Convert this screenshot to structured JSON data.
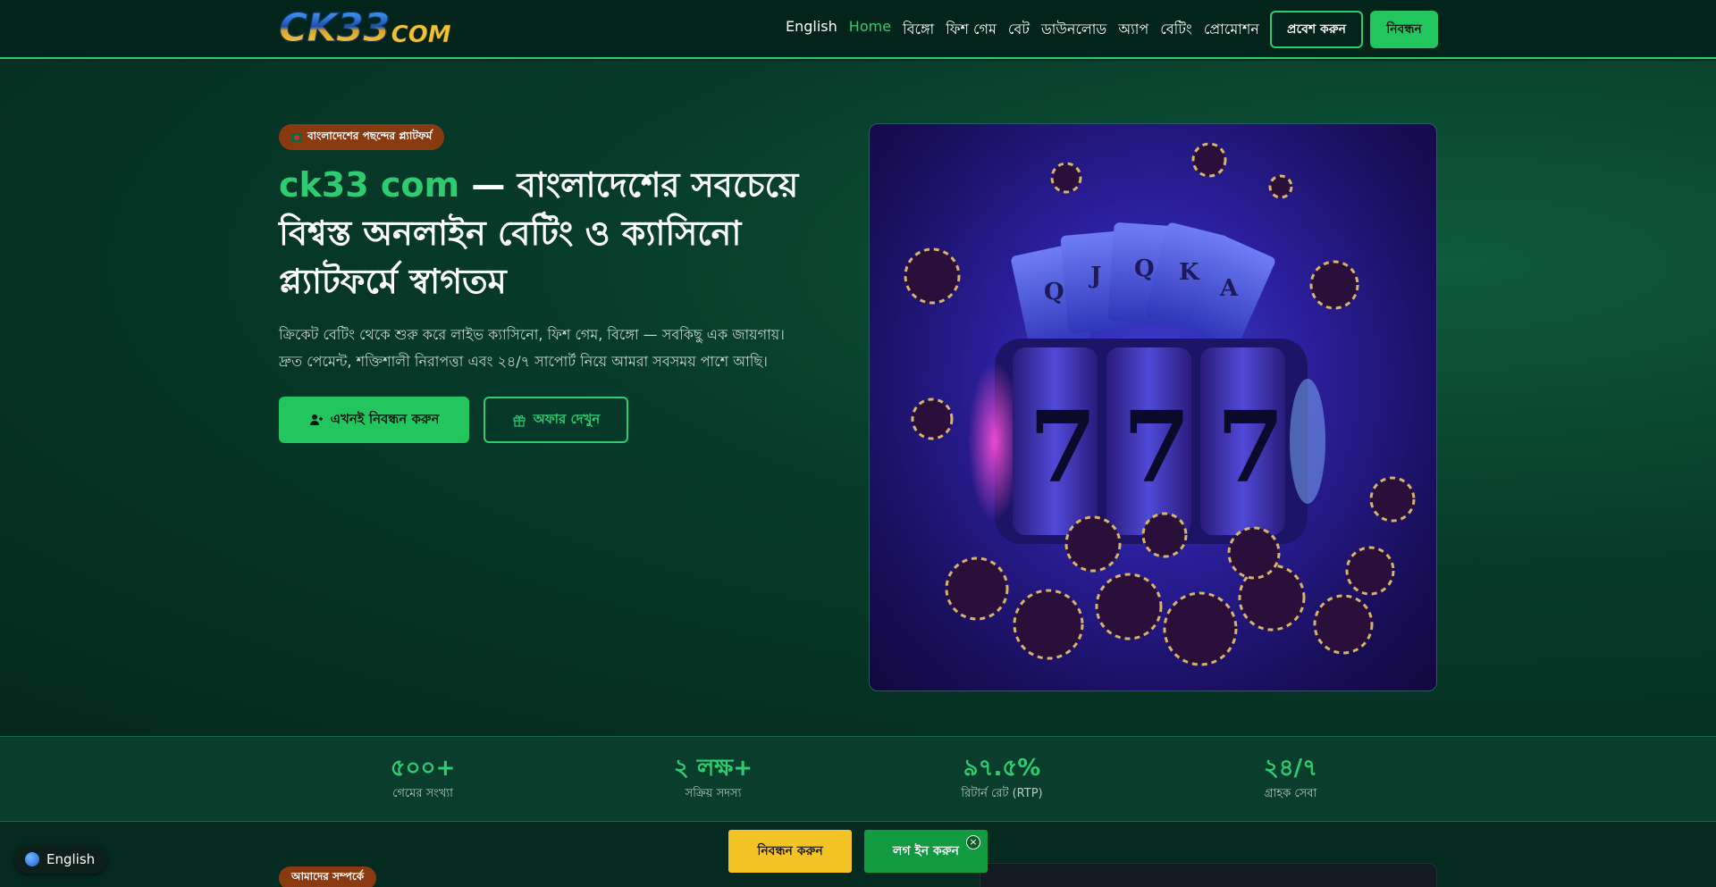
{
  "header": {
    "logo_main": "CK33",
    "logo_suffix": "COM",
    "nav": [
      {
        "label": "English",
        "active": false
      },
      {
        "label": "Home",
        "active": true
      },
      {
        "label": "বিঙ্গো",
        "active": false
      },
      {
        "label": "ফিশ গেম",
        "active": false
      },
      {
        "label": "বেট",
        "active": false
      },
      {
        "label": "ডাউনলোড",
        "active": false
      },
      {
        "label": "অ্যাপ",
        "active": false
      },
      {
        "label": "বেটিং",
        "active": false
      },
      {
        "label": "প্রোমোশন",
        "active": false
      }
    ],
    "login_label": "প্রবেশ করুন",
    "register_label": "নিবন্ধন"
  },
  "hero": {
    "badge": "বাংলাদেশের পছন্দের প্ল্যাটফর্ম",
    "title_accent": "ck33 com",
    "title_rest": " — বাংলাদেশের সবচেয়ে বিশ্বস্ত অনলাইন বেটিং ও ক্যাসিনো প্ল্যাটফর্মে স্বাগতম",
    "desc_line1": "ক্রিকেট বেটিং থেকে শুরু করে লাইভ ক্যাসিনো, ফিশ গেম, বিঙ্গো — সবকিছু এক জায়গায়।",
    "desc_line2": "দ্রুত পেমেন্ট, শক্তিশালী নিরাপত্তা এবং ২৪/৭ সাপোর্ট নিয়ে আমরা সবসময় পাশে আছি।",
    "cta_primary": "এখনই নিবন্ধন করুন",
    "cta_secondary": "অফার দেখুন"
  },
  "stats": [
    {
      "value": "৫০০+",
      "label": "গেমের সংখ্যা"
    },
    {
      "value": "২ লক্ষ+",
      "label": "সক্রিয় সদস্য"
    },
    {
      "value": "৯৭.৫%",
      "label": "রিটার্ন রেট (RTP)"
    },
    {
      "value": "২৪/৭",
      "label": "গ্রাহক সেবা"
    }
  ],
  "footer_bar": {
    "language": "English",
    "about_badge": "আমাদের সম্পর্কে",
    "sticky_register": "নিবন্ধন করুন",
    "sticky_login": "লগ ইন করুন",
    "close_glyph": "×"
  },
  "colors": {
    "accent": "#2ecc71",
    "primary_button": "#22c55e",
    "sticky_register": "#f4c326",
    "sticky_login": "#119a3f",
    "badge": "#8a3a10"
  }
}
